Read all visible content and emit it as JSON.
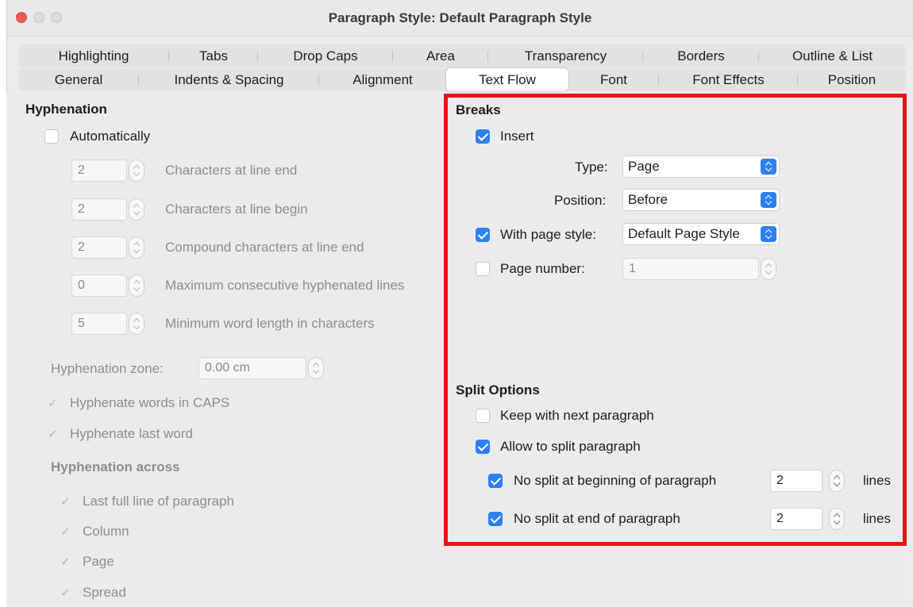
{
  "window": {
    "title": "Paragraph Style: Default Paragraph Style"
  },
  "tabs_row1": [
    "Highlighting",
    "Tabs",
    "Drop Caps",
    "Area",
    "Transparency",
    "Borders",
    "Outline & List"
  ],
  "tabs_row2": [
    "General",
    "Indents & Spacing",
    "Alignment",
    "Text Flow",
    "Font",
    "Font Effects",
    "Position"
  ],
  "active_tab": "Text Flow",
  "hyphenation": {
    "heading": "Hyphenation",
    "automatically": {
      "label": "Automatically",
      "checked": false
    },
    "fields": [
      {
        "value": "2",
        "label": "Characters at line end"
      },
      {
        "value": "2",
        "label": "Characters at line begin"
      },
      {
        "value": "2",
        "label": "Compound characters at line end"
      },
      {
        "value": "0",
        "label": "Maximum consecutive hyphenated lines"
      },
      {
        "value": "5",
        "label": "Minimum word length in characters"
      }
    ],
    "zone": {
      "label": "Hyphenation zone:",
      "value": "0.00 cm"
    },
    "caps": {
      "label": "Hyphenate words in CAPS",
      "checked": true
    },
    "last_word": {
      "label": "Hyphenate last word",
      "checked": true
    },
    "across": {
      "heading": "Hyphenation across",
      "items": [
        {
          "label": "Last full line of paragraph",
          "checked": true
        },
        {
          "label": "Column",
          "checked": true
        },
        {
          "label": "Page",
          "checked": true
        },
        {
          "label": "Spread",
          "checked": true
        }
      ]
    }
  },
  "breaks": {
    "heading": "Breaks",
    "insert": {
      "label": "Insert",
      "checked": true
    },
    "type": {
      "label": "Type:",
      "value": "Page"
    },
    "position": {
      "label": "Position:",
      "value": "Before"
    },
    "page_style": {
      "label": "With page style:",
      "checked": true,
      "value": "Default Page Style"
    },
    "page_number": {
      "label": "Page number:",
      "checked": false,
      "value": "1"
    }
  },
  "split": {
    "heading": "Split Options",
    "keep_with_next": {
      "label": "Keep with next paragraph",
      "checked": false
    },
    "allow_split": {
      "label": "Allow to split paragraph",
      "checked": true
    },
    "no_split_begin": {
      "label": "No split at beginning of paragraph",
      "checked": true,
      "value": "2",
      "unit": "lines"
    },
    "no_split_end": {
      "label": "No split at end of paragraph",
      "checked": true,
      "value": "2",
      "unit": "lines"
    }
  },
  "colors": {
    "accent": "#2d7ff3",
    "highlight_border": "#e8131a",
    "close_button": "#ee5c55"
  }
}
